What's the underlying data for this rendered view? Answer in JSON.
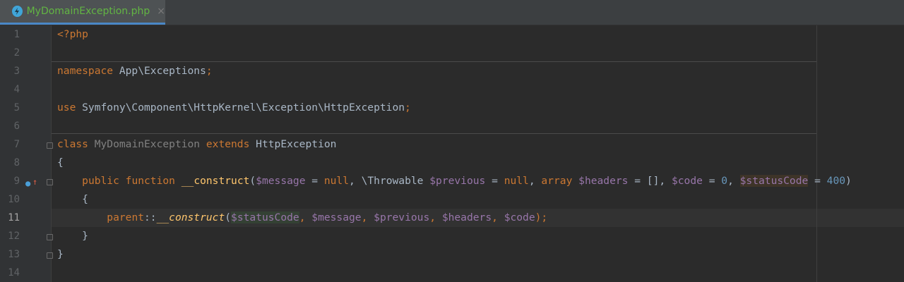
{
  "tab": {
    "filename": "MyDomainException.php",
    "close_glyph": "×",
    "icon": "php-file-icon"
  },
  "gutter": {
    "line_numbers": [
      "1",
      "2",
      "3",
      "4",
      "5",
      "6",
      "7",
      "8",
      "9",
      "10",
      "11",
      "12",
      "13",
      "14"
    ],
    "current_line": "11",
    "override_icon": "override-method-icon"
  },
  "code": {
    "l1": {
      "open_tag": "<?php"
    },
    "l3": {
      "kw": "namespace",
      "rest": " App\\Exceptions",
      "semi": ";"
    },
    "l5": {
      "kw": "use",
      "rest": " Symfony\\Component\\HttpKernel\\Exception\\HttpException",
      "semi": ";"
    },
    "l7": {
      "kw": "class",
      "name": " MyDomainException ",
      "kw2": "extends",
      "parent": " HttpException"
    },
    "l8": {
      "text": "{"
    },
    "l9": {
      "indent": "    ",
      "kw_public": "public",
      "kw_function": " function ",
      "fn": "__construct",
      "p1": "(",
      "v_message": "$message",
      "eq1": " = ",
      "null1": "null",
      "c1": ", \\Throwable ",
      "v_previous": "$previous",
      "eq2": " = ",
      "null2": "null",
      "c2": ", ",
      "kw_array": "array",
      "sp": " ",
      "v_headers": "$headers",
      "eq3": " = [], ",
      "v_code": "$code",
      "eq4": " = ",
      "zero": "0",
      "c3": ", ",
      "v_status": "$statusCode",
      "eq5": " = ",
      "n400": "400",
      "p2": ")"
    },
    "l10": {
      "text": "    {"
    },
    "l11": {
      "indent": "        ",
      "parent_kw": "parent",
      "dc": "::",
      "fn": "__construct",
      "p1": "(",
      "v_status": "$statusCode",
      "c1": ", ",
      "v_message": "$message",
      "c2": ", ",
      "v_previous": "$previous",
      "c3": ", ",
      "v_headers": "$headers",
      "c4": ", ",
      "v_code": "$code",
      "p2": ")",
      "semi": ";"
    },
    "l12": {
      "text": "    }"
    },
    "l13": {
      "text": "}"
    }
  },
  "colors": {
    "keyword": "#cc7832",
    "variable": "#9876aa",
    "number": "#6897bb",
    "function": "#ffc66d",
    "text": "#a9b7c6",
    "background": "#2b2b2b",
    "tab_filename": "#62b543"
  }
}
